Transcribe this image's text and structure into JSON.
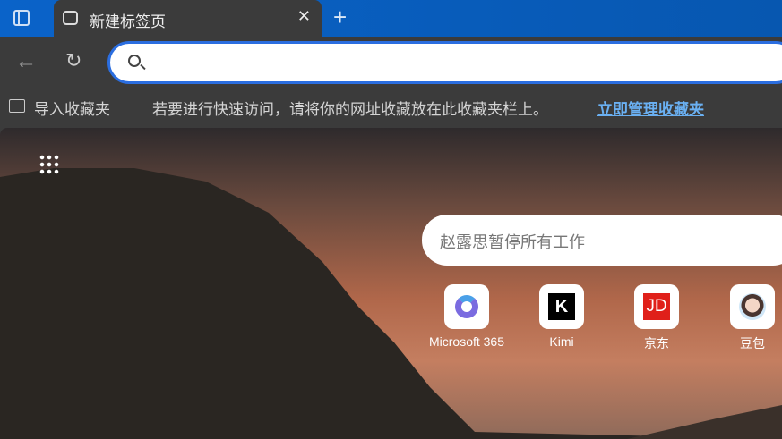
{
  "tab": {
    "title": "新建标签页"
  },
  "address": {
    "value": "",
    "placeholder": ""
  },
  "favorites": {
    "import": "导入收藏夹",
    "hint": "若要进行快速访问，请将你的网址收藏放在此收藏夹栏上。",
    "manage": "立即管理收藏夹"
  },
  "search": {
    "placeholder": "赵露思暂停所有工作"
  },
  "tiles": [
    {
      "label": "Microsoft 365"
    },
    {
      "label": "Kimi"
    },
    {
      "label": "京东"
    },
    {
      "label": "豆包"
    }
  ]
}
